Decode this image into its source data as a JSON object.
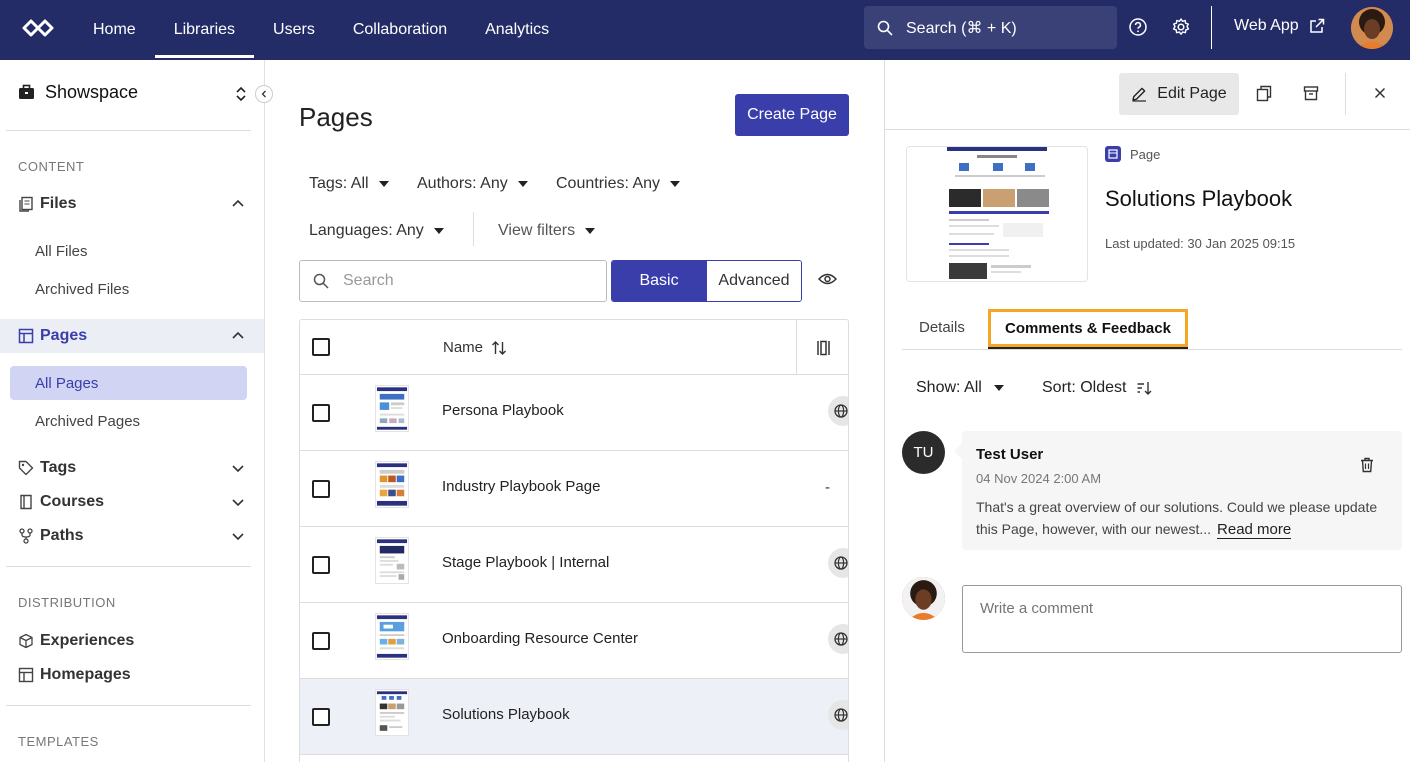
{
  "topbar": {
    "nav": [
      "Home",
      "Libraries",
      "Users",
      "Collaboration",
      "Analytics"
    ],
    "active_nav": "Libraries",
    "search_label": "Search (⌘ + K)",
    "web_app_label": "Web App"
  },
  "sidebar": {
    "workspace": "Showspace",
    "content_heading": "CONTENT",
    "files_label": "Files",
    "all_files": "All Files",
    "archived_files": "Archived Files",
    "pages_label": "Pages",
    "all_pages": "All Pages",
    "archived_pages": "Archived Pages",
    "tags_label": "Tags",
    "courses_label": "Courses",
    "paths_label": "Paths",
    "distribution_heading": "DISTRIBUTION",
    "experiences_label": "Experiences",
    "homepages_label": "Homepages",
    "templates_heading": "TEMPLATES"
  },
  "main": {
    "title": "Pages",
    "create_button": "Create Page",
    "filters": {
      "tags": "Tags: All",
      "authors": "Authors: Any",
      "countries": "Countries: Any",
      "languages": "Languages: Any",
      "view_filters": "View filters"
    },
    "search_placeholder": "Search",
    "segment_basic": "Basic",
    "segment_advanced": "Advanced",
    "column_name": "Name",
    "rows": [
      {
        "name": "Persona Playbook",
        "status": "globe"
      },
      {
        "name": "Industry Playbook Page",
        "status": "-"
      },
      {
        "name": "Stage Playbook | Internal",
        "status": "globe"
      },
      {
        "name": "Onboarding Resource Center",
        "status": "globe"
      },
      {
        "name": "Solutions Playbook",
        "status": "globe"
      }
    ]
  },
  "panel": {
    "edit_button": "Edit Page",
    "type_label": "Page",
    "title": "Solutions Playbook",
    "last_updated": "Last updated: 30 Jan 2025 09:15",
    "tab_details": "Details",
    "tab_comments": "Comments & Feedback",
    "show_filter": "Show: All",
    "sort_filter": "Sort: Oldest",
    "comment": {
      "initials": "TU",
      "author": "Test User",
      "date": "04 Nov 2024 2:00 AM",
      "text": "That's a great overview of our solutions. Could we please update this Page, however, with our newest...",
      "read_more": "Read more"
    },
    "comment_placeholder": "Write a comment"
  },
  "colors": {
    "topbar_bg": "#242c68",
    "primary": "#3a3eab",
    "active_tab_outline": "#f5a623"
  }
}
